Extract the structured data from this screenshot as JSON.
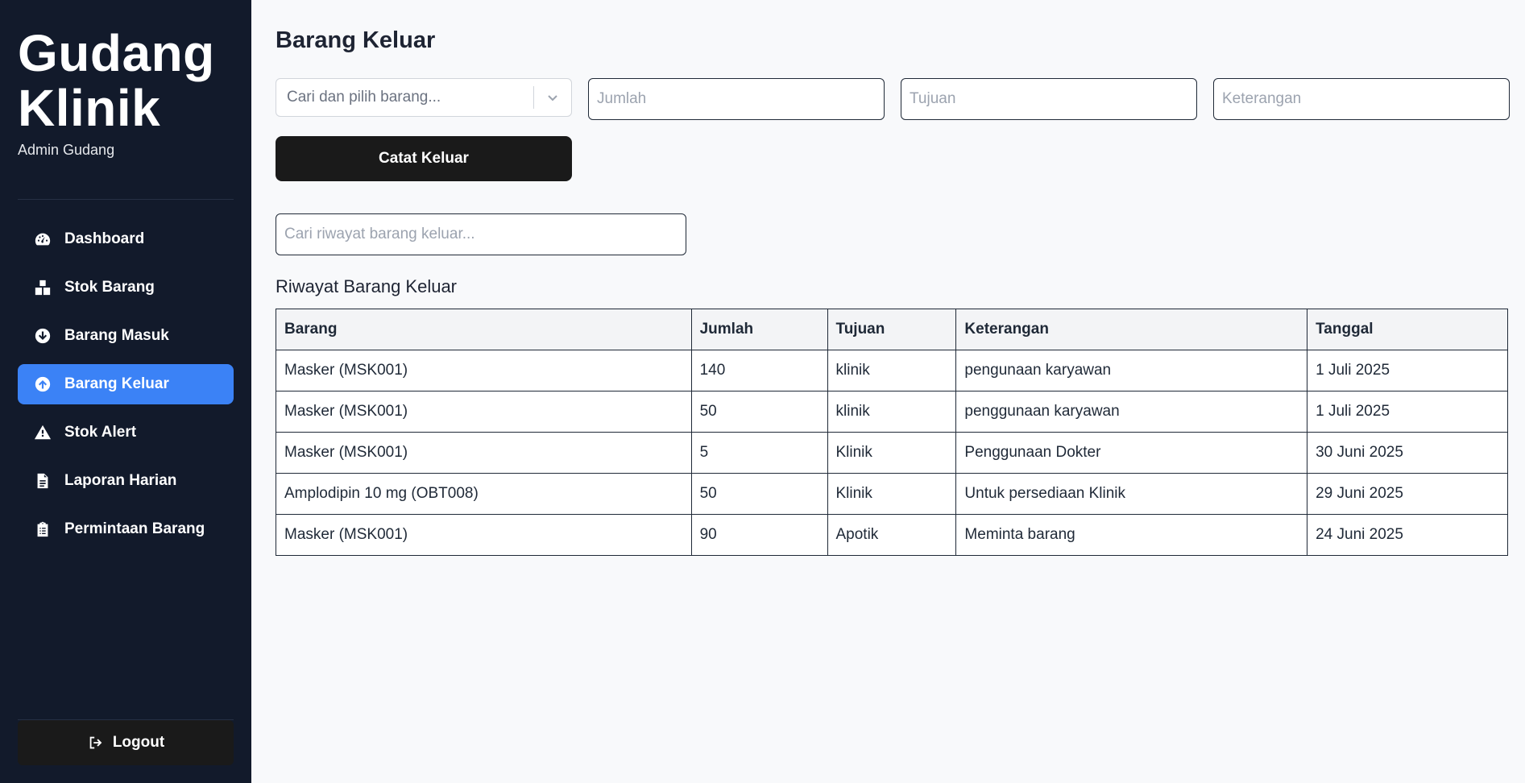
{
  "sidebar": {
    "brand_line1": "Gudang",
    "brand_line2": "Klinik",
    "subtitle": "Admin Gudang",
    "items": [
      {
        "label": "Dashboard",
        "icon": "gauge-icon"
      },
      {
        "label": "Stok Barang",
        "icon": "boxes-icon"
      },
      {
        "label": "Barang Masuk",
        "icon": "arrow-circle-down-icon"
      },
      {
        "label": "Barang Keluar",
        "icon": "arrow-circle-up-icon",
        "active": true
      },
      {
        "label": "Stok Alert",
        "icon": "warning-icon"
      },
      {
        "label": "Laporan Harian",
        "icon": "document-icon"
      },
      {
        "label": "Permintaan Barang",
        "icon": "clipboard-list-icon"
      }
    ],
    "logout_label": "Logout"
  },
  "main": {
    "title": "Barang Keluar",
    "form": {
      "select_placeholder": "Cari dan pilih barang...",
      "jumlah_placeholder": "Jumlah",
      "tujuan_placeholder": "Tujuan",
      "keterangan_placeholder": "Keterangan",
      "submit_label": "Catat Keluar"
    },
    "history_search_placeholder": "Cari riwayat barang keluar...",
    "history_title": "Riwayat Barang Keluar",
    "table": {
      "headers": [
        "Barang",
        "Jumlah",
        "Tujuan",
        "Keterangan",
        "Tanggal"
      ],
      "rows": [
        [
          "Masker (MSK001)",
          "140",
          "klinik",
          "pengunaan karyawan",
          "1 Juli 2025"
        ],
        [
          "Masker (MSK001)",
          "50",
          "klinik",
          "penggunaan karyawan",
          "1 Juli 2025"
        ],
        [
          "Masker (MSK001)",
          "5",
          "Klinik",
          "Penggunaan Dokter",
          "30 Juni 2025"
        ],
        [
          "Amplodipin 10 mg (OBT008)",
          "50",
          "Klinik",
          "Untuk persediaan Klinik",
          "29 Juni 2025"
        ],
        [
          "Masker (MSK001)",
          "90",
          "Apotik",
          "Meminta barang",
          "24 Juni 2025"
        ]
      ]
    }
  },
  "colors": {
    "sidebar_bg": "#121a2b",
    "accent": "#3b82f6",
    "button_dark": "#1a1a1a"
  }
}
